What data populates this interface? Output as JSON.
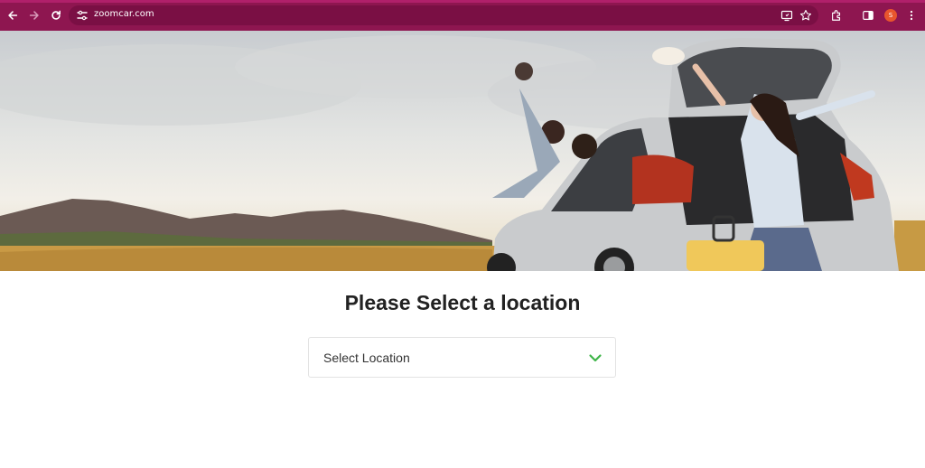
{
  "browser": {
    "url": "zoomcar.com",
    "profile_initial": "S",
    "theme_color": "#8e1650"
  },
  "icons": {
    "back": "back-arrow-icon",
    "forward": "forward-arrow-icon",
    "reload": "reload-icon",
    "site_info": "tune-icon",
    "install": "install-app-icon",
    "bookmark": "star-icon",
    "extensions": "puzzle-icon",
    "side_panel": "side-panel-icon",
    "menu": "kebab-menu-icon",
    "dropdown": "chevron-down-icon"
  },
  "page": {
    "title": "Please Select a location",
    "select": {
      "label": "Select Location",
      "accent_color": "#3fb549"
    }
  }
}
